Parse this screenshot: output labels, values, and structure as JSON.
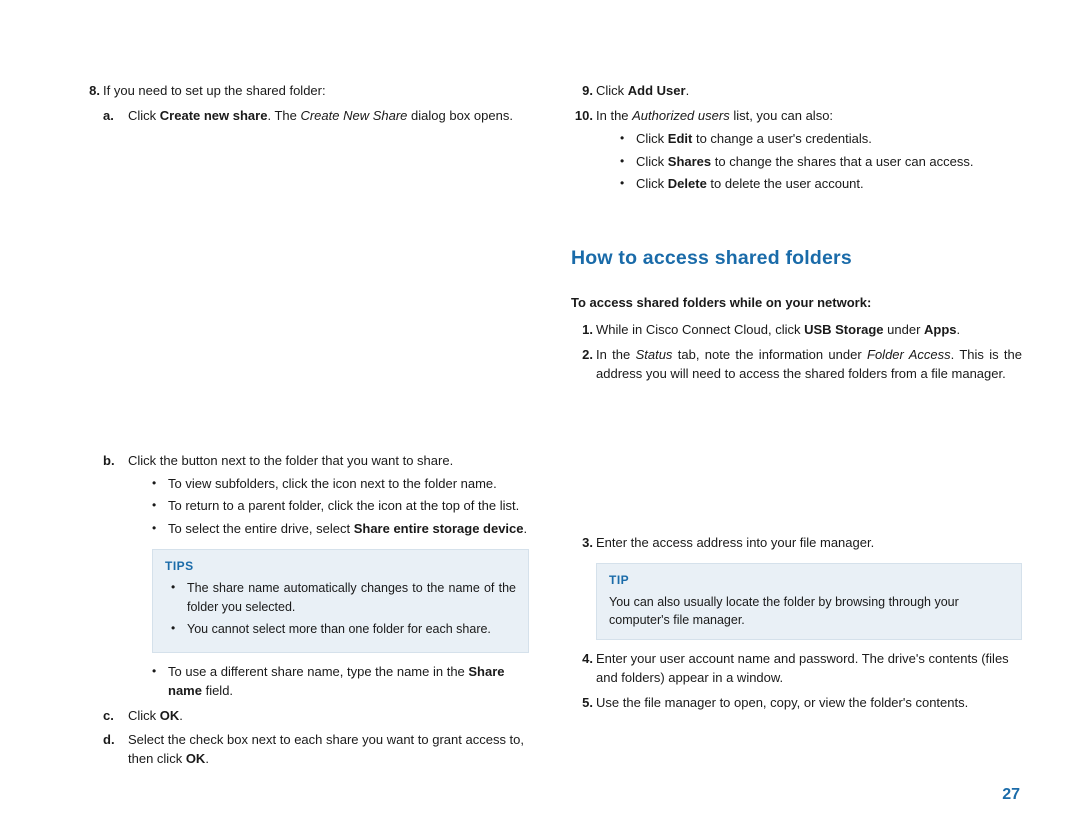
{
  "page_number": "27",
  "left": {
    "step8": {
      "num": "8.",
      "text": "If you need to set up the shared folder:",
      "a": {
        "mk": "a.",
        "pre": "Click ",
        "bold": "Create new share",
        "post": ". The ",
        "ital": "Create New Share",
        "after": " dialog box opens."
      },
      "b": {
        "mk": "b.",
        "text": "Click the button next to the folder that you want to share.",
        "bullets": {
          "view_pre": "To view subfolders, click the ",
          "view_post": " icon next to the folder name.",
          "ret_pre": "To return to a parent folder, click the ",
          "ret_post": " icon at the top of the list.",
          "sel_pre": "To select the entire drive, select ",
          "sel_bold": "Share entire storage device",
          "sel_post": "."
        },
        "tips": {
          "label": "TIPS",
          "t1": "The share name automatically changes to the name of the folder you selected.",
          "t2": "You cannot select more than one folder for each share."
        },
        "use_pre": "To use a different share name, type the name in the ",
        "use_bold": "Share name",
        "use_post": " field."
      },
      "c": {
        "mk": "c.",
        "pre": "Click ",
        "bold": "OK",
        "post": "."
      },
      "d": {
        "mk": "d.",
        "pre": "Select the check box next to each share you want to grant access to, then click ",
        "bold": "OK",
        "post": "."
      }
    }
  },
  "right": {
    "step9": {
      "num": "9.",
      "pre": "Click ",
      "bold": "Add User",
      "post": "."
    },
    "step10": {
      "num": "10.",
      "pre": "In the ",
      "ital": "Authorized users",
      "post": " list, you can also:",
      "b1_pre": "Click ",
      "b1_bold": "Edit",
      "b1_post": " to change a user's credentials.",
      "b2_pre": "Click ",
      "b2_bold": "Shares",
      "b2_post": " to change the shares that a user can access.",
      "b3_pre": "Click ",
      "b3_bold": "Delete",
      "b3_post": " to delete the user account."
    },
    "heading": "How to access shared folders",
    "lead": "To access shared folders while on your network:",
    "s1": {
      "num": "1.",
      "pre": "While in Cisco Connect Cloud, click ",
      "bold": "USB Storage",
      "mid": " under ",
      "bold2": "Apps",
      "post": "."
    },
    "s2": {
      "num": "2.",
      "pre": "In the ",
      "ital": "Status",
      "mid": " tab, note the information under ",
      "ital2": "Folder Access",
      "post": ". This is the address you will need to access the shared folders from a file manager."
    },
    "s3": {
      "num": "3.",
      "text": "Enter the access address into your file manager."
    },
    "tip": {
      "label": "TIP",
      "text": "You can also usually locate the folder by browsing through your computer's file manager."
    },
    "s4": {
      "num": "4.",
      "text": "Enter your user account name and password. The drive's contents (files and folders) appear in a window."
    },
    "s5": {
      "num": "5.",
      "text": "Use the file manager to open, copy, or view the folder's contents."
    }
  }
}
